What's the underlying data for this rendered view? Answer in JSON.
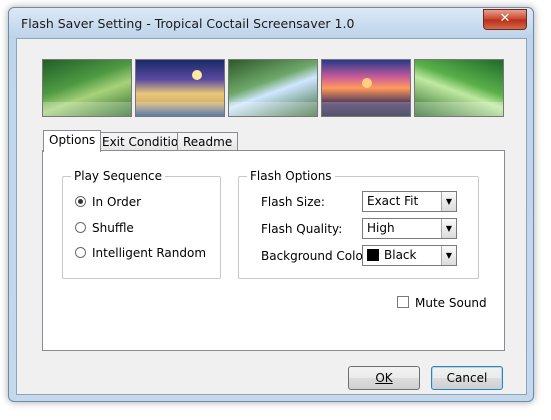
{
  "window": {
    "title": "Flash Saver Setting - Tropical Coctail Screensaver 1.0",
    "close_label": "✕"
  },
  "banner": {
    "thumbnails": [
      "jungle-waterfall",
      "tropical-beach-night",
      "jungle-waterfall-2",
      "sunset-coast",
      "jungle-lagoon"
    ]
  },
  "tabs": [
    {
      "label": "Options",
      "active": true
    },
    {
      "label": "Exit Conditions",
      "active": false
    },
    {
      "label": "Readme",
      "active": false
    }
  ],
  "play_sequence": {
    "label": "Play Sequence",
    "options": [
      {
        "label": "In Order",
        "selected": true
      },
      {
        "label": "Shuffle",
        "selected": false
      },
      {
        "label": "Intelligent Random",
        "selected": false
      }
    ]
  },
  "flash_options": {
    "label": "Flash Options",
    "fields": [
      {
        "label": "Flash Size:",
        "value": "Exact Fit"
      },
      {
        "label": "Flash Quality:",
        "value": "High"
      },
      {
        "label": "Background Color:",
        "value": "Black",
        "swatch": "#000000"
      }
    ]
  },
  "mute_sound": {
    "label": "Mute Sound",
    "checked": false
  },
  "buttons": {
    "ok": "OK",
    "cancel": "Cancel"
  }
}
